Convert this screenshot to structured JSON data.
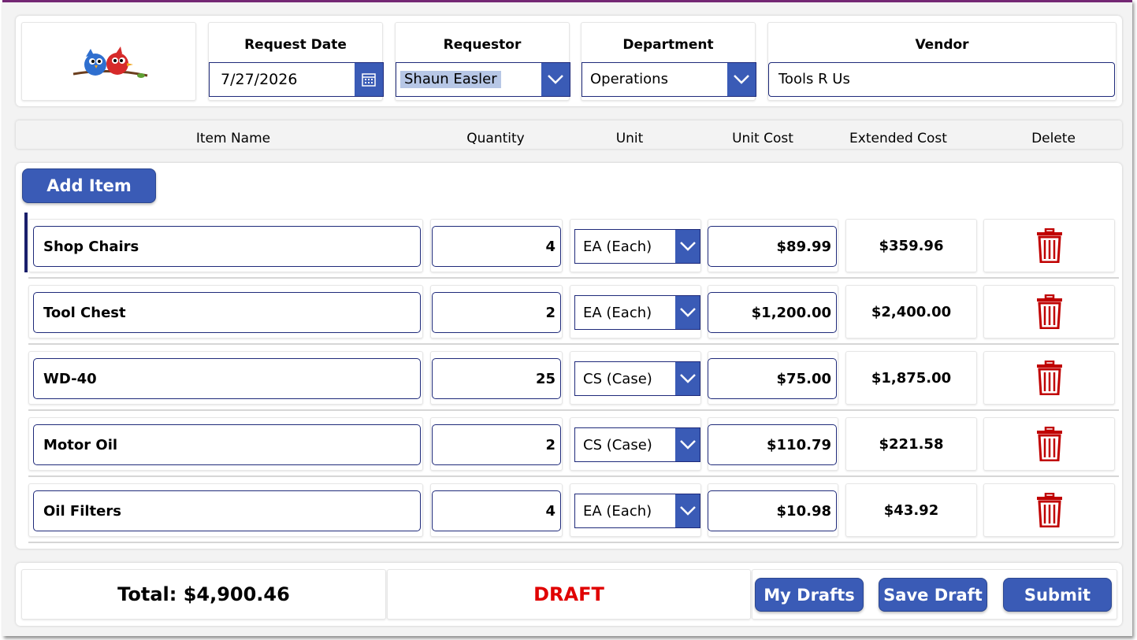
{
  "header": {
    "request_date_label": "Request Date",
    "request_date_value": "7/27/2026",
    "requestor_label": "Requestor",
    "requestor_value": "Shaun Easler",
    "department_label": "Department",
    "department_value": "Operations",
    "vendor_label": "Vendor",
    "vendor_value": "Tools R Us"
  },
  "columns": [
    "Item Name",
    "Quantity",
    "Unit",
    "Unit Cost",
    "Extended Cost",
    "Delete"
  ],
  "add_item_label": "Add Item",
  "items": [
    {
      "name": "Shop Chairs",
      "quantity": "4",
      "unit": "EA (Each)",
      "unit_cost": "$89.99",
      "extended_cost": "$359.96"
    },
    {
      "name": "Tool Chest",
      "quantity": "2",
      "unit": "EA (Each)",
      "unit_cost": "$1,200.00",
      "extended_cost": "$2,400.00"
    },
    {
      "name": "WD-40",
      "quantity": "25",
      "unit": "CS (Case)",
      "unit_cost": "$75.00",
      "extended_cost": "$1,875.00"
    },
    {
      "name": "Motor Oil",
      "quantity": "2",
      "unit": "CS (Case)",
      "unit_cost": "$110.79",
      "extended_cost": "$221.58"
    },
    {
      "name": "Oil Filters",
      "quantity": "4",
      "unit": "EA (Each)",
      "unit_cost": "$10.98",
      "extended_cost": "$43.92"
    }
  ],
  "footer": {
    "total": "Total: $4,900.46",
    "status": "DRAFT",
    "my_drafts_label": "My Drafts",
    "save_draft_label": "Save Draft",
    "submit_label": "Submit"
  },
  "colors": {
    "accent": "#3a5bb6",
    "border": "#1f2a7a",
    "status_draft": "#e00000",
    "delete_icon": "#c00000",
    "topbar": "#742774"
  },
  "icons": {
    "logo": "two-birds-logo",
    "date_picker": "calendar-icon",
    "dropdown": "chevron-down-icon",
    "delete": "trash-icon"
  }
}
